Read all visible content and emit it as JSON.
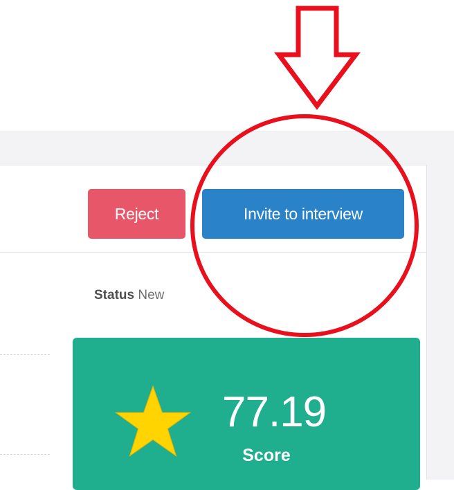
{
  "actions": {
    "reject_label": "Reject",
    "invite_label": "Invite to interview"
  },
  "status": {
    "label": "Status",
    "value": "New"
  },
  "score": {
    "value": "77.19",
    "label": "Score",
    "icon": "star-icon"
  },
  "annotation": {
    "arrow_icon": "down-arrow-icon",
    "highlight": "circle-highlight",
    "color": "#e8101c"
  },
  "colors": {
    "reject": "#e8566a",
    "invite": "#2a82c9",
    "score_card": "#1faf8f",
    "star": "#ffd400"
  }
}
